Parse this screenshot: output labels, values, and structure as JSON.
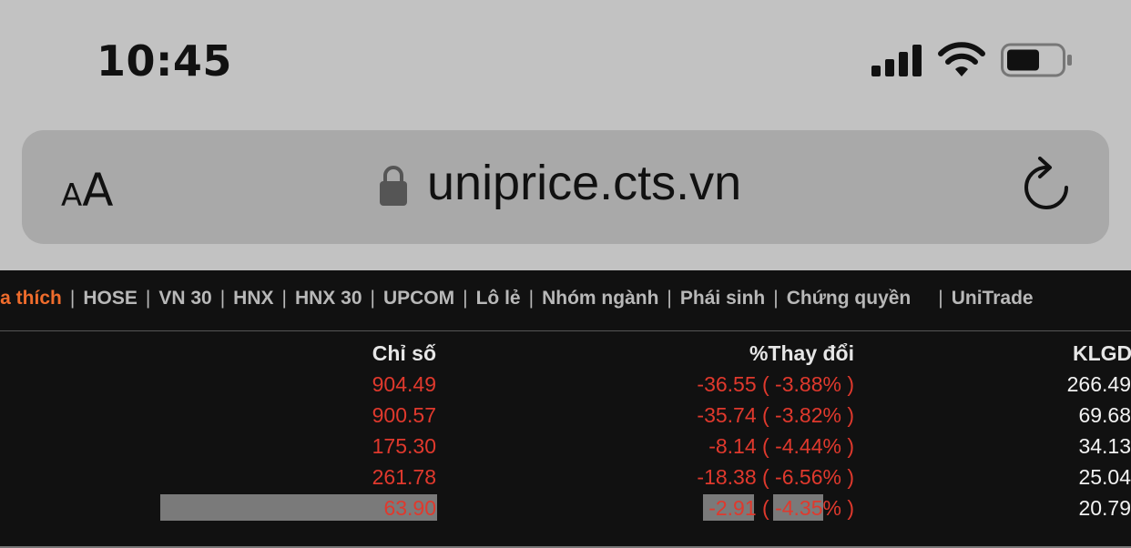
{
  "status_bar": {
    "time": "10:45"
  },
  "browser": {
    "text_size_small": "A",
    "text_size_big": "A",
    "url": "uniprice.cts.vn"
  },
  "nav": {
    "items": [
      {
        "label": "ra thích",
        "active": true
      },
      {
        "label": "HOSE",
        "active": false
      },
      {
        "label": "VN 30",
        "active": false
      },
      {
        "label": "HNX",
        "active": false
      },
      {
        "label": "HNX 30",
        "active": false
      },
      {
        "label": "UPCOM",
        "active": false
      },
      {
        "label": "Lô lẻ",
        "active": false
      },
      {
        "label": "Nhóm ngành",
        "active": false
      },
      {
        "label": "Phái sinh",
        "active": false
      },
      {
        "label": "Chứng quyền",
        "active": false
      },
      {
        "label": "UniTrade",
        "active": false
      }
    ],
    "separator": "|",
    "active_color": "#ef6c2c"
  },
  "table": {
    "headers": {
      "index": "Chỉ số",
      "change": "%Thay đổi",
      "volume": "KLGD"
    },
    "rows": [
      {
        "index": "904.49",
        "change": "-36.55 ( -3.88% )",
        "volume": "266.49"
      },
      {
        "index": "900.57",
        "change": "-35.74 ( -3.82% )",
        "volume": "69.68"
      },
      {
        "index": "175.30",
        "change": "-8.14 ( -4.44% )",
        "volume": "34.13"
      },
      {
        "index": "261.78",
        "change": "-18.38 ( -6.56% )",
        "volume": "25.04"
      },
      {
        "index": "63.90",
        "change": "-2.91 ( -4.35% )",
        "volume": "20.79"
      }
    ],
    "down_color": "#e0392d"
  }
}
